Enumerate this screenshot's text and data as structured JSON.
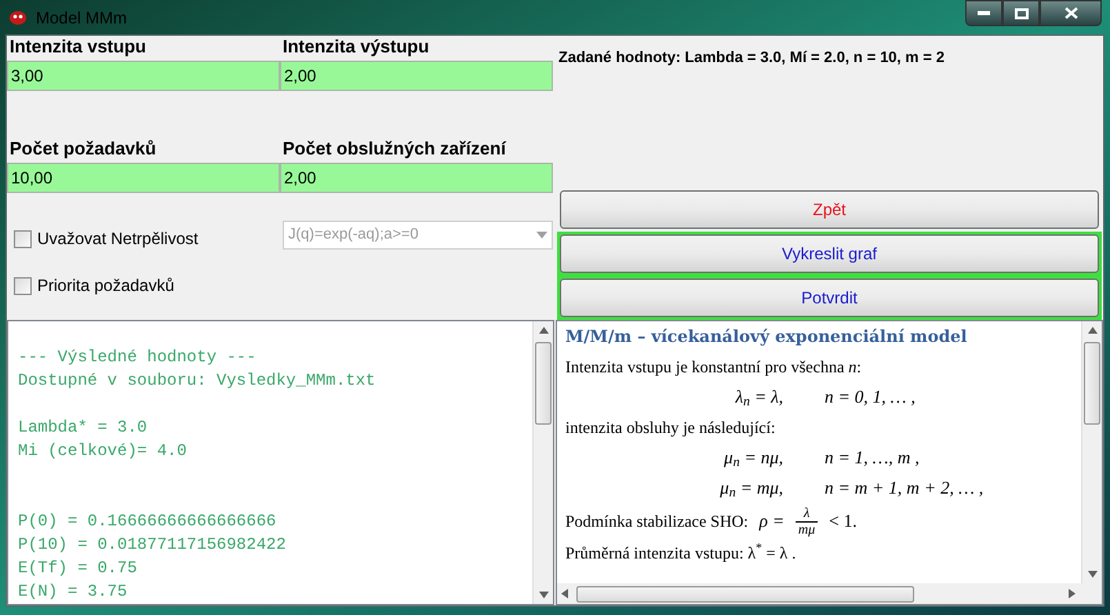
{
  "window": {
    "title": "Model MMm"
  },
  "inputs": [
    {
      "label": "Intenzita vstupu",
      "value": "3,00"
    },
    {
      "label": "Intenzita výstupu",
      "value": "2,00"
    },
    {
      "label": "Počet požadavků",
      "value": "10,00"
    },
    {
      "label": "Počet obslužných zařízení",
      "value": "2,00"
    }
  ],
  "summary": "Zadané hodnoty: Lambda = 3.0, Mí = 2.0, n = 10, m = 2",
  "buttons": [
    {
      "label": "Zpět",
      "kind": "back",
      "highlighted": false
    },
    {
      "label": "Vykreslit graf",
      "kind": "action",
      "highlighted": true
    },
    {
      "label": "Potvrdit",
      "kind": "action",
      "highlighted": true
    }
  ],
  "checkboxes": [
    {
      "label": "Uvažovat Netrpělivost",
      "checked": false
    },
    {
      "label": "Priorita požadavků",
      "checked": false
    }
  ],
  "dropdown": {
    "value": "J(q)=exp(-aq);a>=0",
    "disabled": true
  },
  "results": [
    [
      "--- Výsledné hodnoty ---",
      "Dostupné v souboru: Vysledky_MMm.txt"
    ],
    [
      "Lambda* = 3.0",
      "Mi (celkové)= 4.0"
    ],
    [
      "P(0) = 0.16666666666666666",
      "P(10) = 0.01877117156982422",
      "E(Tf) = 0.75",
      "E(N) = 3.75"
    ]
  ],
  "doc": [
    {
      "kind": "heading",
      "text": "M/M/m – vícekanálový  exponenciální  model"
    },
    {
      "kind": "para",
      "text": "Intenzita vstupu je konstantní pro všechna *n*:"
    },
    {
      "kind": "formula",
      "lhs": "λ$_{n}$ = λ,",
      "rhs": "n = 0, 1, … ,"
    },
    {
      "kind": "para",
      "text": "intenzita  obsluhy je následující:"
    },
    {
      "kind": "formula",
      "lhs": "μ$_{n}$ = nμ,",
      "rhs": "n = 1, …, m  ,"
    },
    {
      "kind": "formula",
      "lhs": "μ$_{n}$ = mμ,",
      "rhs": "n = m + 1, m + 2, … ,"
    },
    {
      "kind": "fraction",
      "text": "Podmínka stabilizace SHO:",
      "lhs": "ρ =",
      "numerator": "λ",
      "denominator": "mμ",
      "rhs": "< 1."
    },
    {
      "kind": "para",
      "text": "Průměrná intenzita vstupu:  λ$^{*}$ = λ ."
    }
  ]
}
